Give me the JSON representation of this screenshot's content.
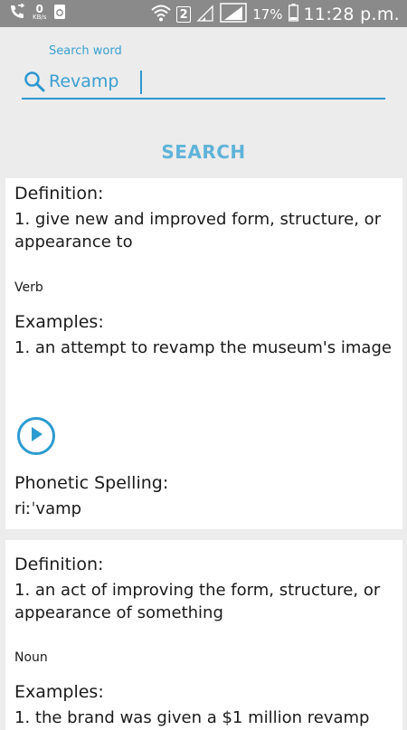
{
  "status_bar": {
    "net_speed_value": "0",
    "net_speed_unit": "KB/s",
    "sim_slot": "2",
    "battery_percent": "17%",
    "time": "11:28 p.m.",
    "icons": [
      "call-forward-icon",
      "recycle-icon",
      "wifi-icon",
      "signal-icon",
      "battery-icon"
    ]
  },
  "search": {
    "label": "Search word",
    "value": "Revamp",
    "button_label": "SEARCH"
  },
  "results": [
    {
      "definition_label": "Definition:",
      "definition": "1. give new and improved form, structure, or appearance to",
      "part_of_speech": "Verb",
      "examples_label": "Examples:",
      "example": "1. an attempt to revamp the museum's image",
      "phonetic_label": "Phonetic Spelling:",
      "phonetic": "riːˈvamp"
    },
    {
      "definition_label": "Definition:",
      "definition": "1. an act of improving the form, structure, or appearance of something",
      "part_of_speech": "Noun",
      "examples_label": "Examples:",
      "example": "1. the brand was given a $1 million revamp"
    }
  ],
  "colors": {
    "accent": "#2c98cf",
    "status_bar": "#8a8a8a",
    "background": "#ececec"
  }
}
